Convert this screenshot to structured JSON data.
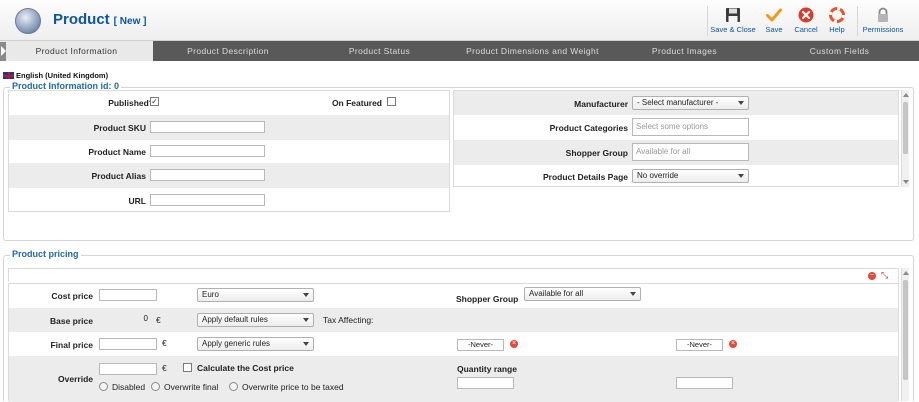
{
  "header": {
    "title": "Product",
    "subtitle": "[ New ]",
    "buttons": [
      {
        "label": "Save & Close",
        "icon": "floppy-icon"
      },
      {
        "label": "Save",
        "icon": "checkmark-icon"
      },
      {
        "label": "Cancel",
        "icon": "cancel-icon"
      },
      {
        "label": "Help",
        "icon": "lifebuoy-icon"
      },
      {
        "label": "Permissions",
        "icon": "lock-icon"
      }
    ]
  },
  "tabs": [
    {
      "label": "Product Information",
      "active": true
    },
    {
      "label": "Product Description"
    },
    {
      "label": "Product Status"
    },
    {
      "label": "Product Dimensions and Weight"
    },
    {
      "label": "Product Images"
    },
    {
      "label": "Custom Fields"
    }
  ],
  "language": "English (United Kingdom)",
  "info": {
    "legend": "Product Information id: 0",
    "published_label": "Published?",
    "published_checked": true,
    "featured_label": "On Featured",
    "sku_label": "Product SKU",
    "name_label": "Product Name",
    "alias_label": "Product Alias",
    "url_label": "URL",
    "manufacturer_label": "Manufacturer",
    "manufacturer_value": "- Select manufacturer -",
    "categories_label": "Product Categories",
    "categories_placeholder": "Select some options",
    "shopper_group_label": "Shopper Group",
    "shopper_group_placeholder": "Available for all",
    "details_page_label": "Product Details Page",
    "details_page_value": "No override"
  },
  "pricing": {
    "legend": "Product pricing",
    "cost_price_label": "Cost price",
    "currency_value": "Euro",
    "base_price_label": "Base price",
    "base_price_value": "0",
    "euro_symbol": "€",
    "base_rules_value": "Apply default rules",
    "tax_affecting_label": "Tax Affecting:",
    "final_price_label": "Final price",
    "final_rules_value": "Apply generic rules",
    "override_label": "Override",
    "calculate_cost_label": "Calculate the Cost price",
    "radio_disabled": "Disabled",
    "radio_overwrite_final": "Overwrite final",
    "radio_overwrite_taxed": "Overwrite price to be taxed",
    "shopper_group_label": "Shopper Group",
    "shopper_group_value": "Available for all",
    "never_from": "-Never-",
    "never_to": "-Never-",
    "quantity_range_label": "Quantity range"
  },
  "colors": {
    "accent": "#0b55a3",
    "tab_bar": "#595959",
    "legend": "#1e6aa8"
  }
}
